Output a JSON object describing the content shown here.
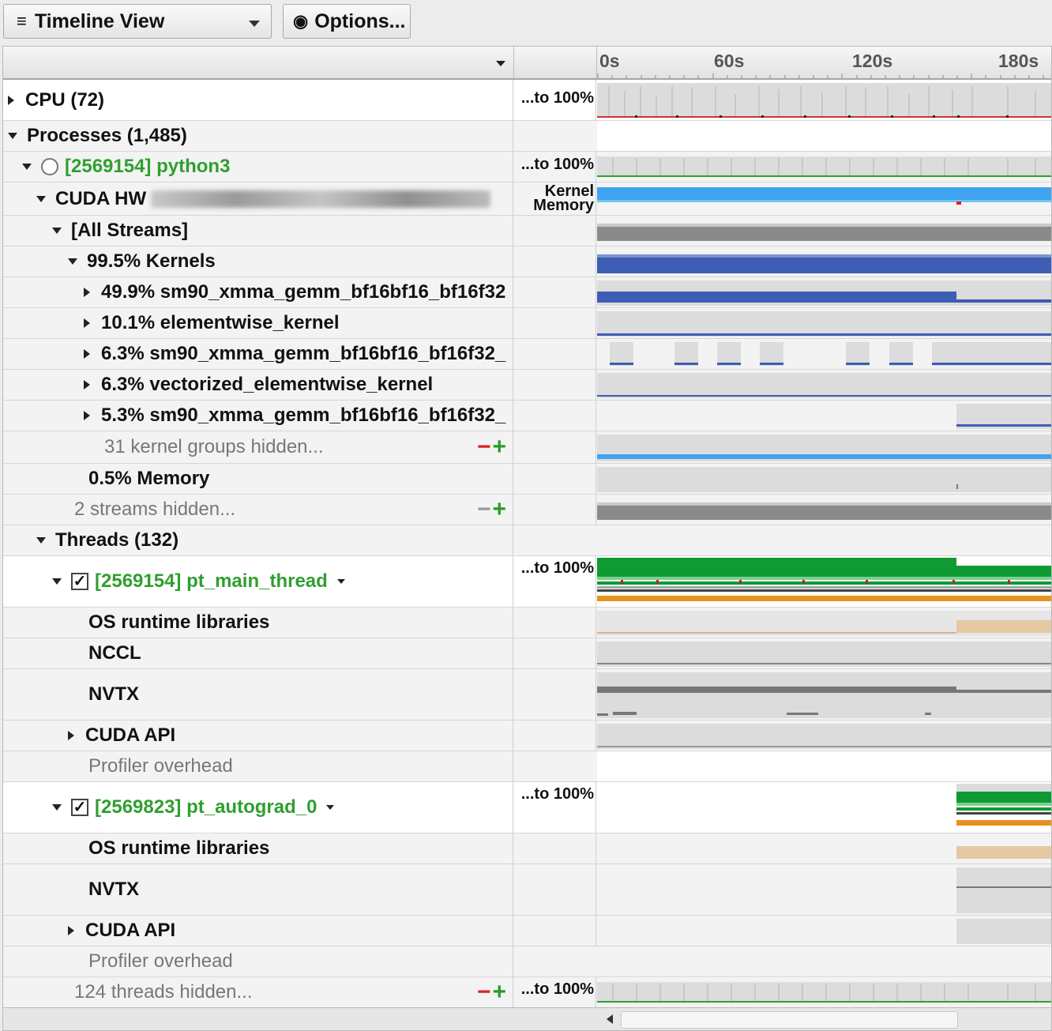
{
  "toolbar": {
    "view_label": "Timeline View",
    "options_label": "Options..."
  },
  "axis": {
    "ticks": [
      "0s",
      "60s",
      "120s",
      "180s"
    ]
  },
  "rows": {
    "cpu": "CPU (72)",
    "cpu_scale": "...to 100%",
    "processes": "Processes (1,485)",
    "python3": "[2569154] python3",
    "python3_scale": "...to 100%",
    "cuda_hw": "CUDA HW",
    "cuda_hw_scale_kernel": "Kernel",
    "cuda_hw_scale_memory": "Memory",
    "all_streams": "[All Streams]",
    "kernels": "99.5% Kernels",
    "k1": "49.9% sm90_xmma_gemm_bf16bf16_bf16f32",
    "k2": "10.1% elementwise_kernel",
    "k3": "6.3% sm90_xmma_gemm_bf16bf16_bf16f32_",
    "k4": "6.3% vectorized_elementwise_kernel",
    "k5": "5.3% sm90_xmma_gemm_bf16bf16_bf16f32_",
    "kernel_groups_hidden": "31 kernel groups hidden...",
    "memory": "0.5% Memory",
    "streams_hidden": "2 streams hidden...",
    "threads": "Threads (132)",
    "main_thread": "[2569154] pt_main_thread",
    "main_thread_scale": "...to 100%",
    "os_runtime_1": "OS runtime libraries",
    "nccl": "NCCL",
    "nvtx_1": "NVTX",
    "cuda_api_1": "CUDA API",
    "profiler_overhead_1": "Profiler overhead",
    "autograd": "[2569823] pt_autograd_0",
    "autograd_scale": "...to 100%",
    "os_runtime_2": "OS runtime libraries",
    "nvtx_2": "NVTX",
    "cuda_api_2": "CUDA API",
    "profiler_overhead_2": "Profiler overhead",
    "threads_hidden": "124 threads hidden...",
    "threads_hidden_scale": "...to 100%"
  },
  "controls": {
    "minus": "−",
    "plus": "+",
    "check": "✓"
  },
  "colors": {
    "kernel_blue": "#3e5db5",
    "memory_blue": "#3fa3ef",
    "thread_green": "#0f9a33",
    "runtime_orange": "#e8921f",
    "cpu_red": "#cc3333",
    "process_green": "#2f9f2f"
  }
}
